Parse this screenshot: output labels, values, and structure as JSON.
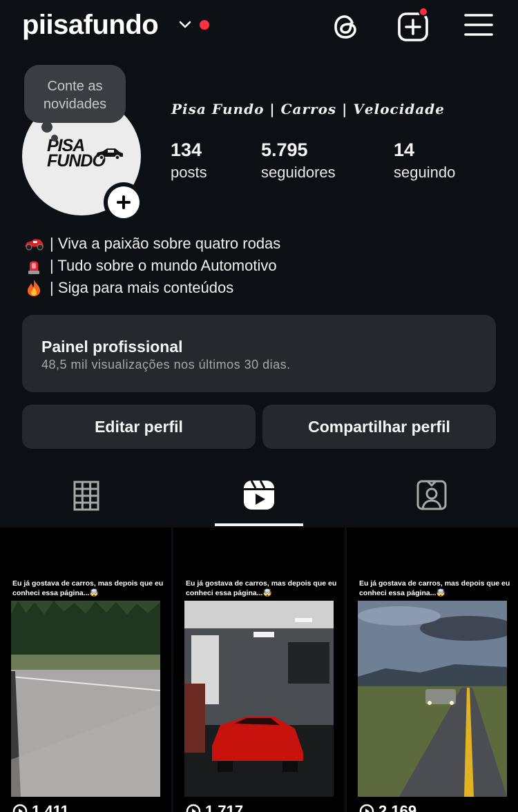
{
  "header": {
    "username": "piisafundo",
    "icons": [
      "chevron-down-icon",
      "threads-icon",
      "new-post-icon",
      "menu-icon"
    ],
    "notification_color": "#ff3040"
  },
  "profile": {
    "note_bubble": "Conte as novidades",
    "avatar_logo_line1": "PISA",
    "avatar_logo_line2": "FUNDO",
    "full_name": "𝑷𝒊𝒔𝒂 𝑭𝒖𝒏𝒅𝒐 | 𝑪𝒂𝒓𝒓𝒐𝒔 | 𝑽𝒆𝒍𝒐𝒄𝒊𝒅𝒂𝒅𝒆",
    "stats": [
      {
        "value": "134",
        "label": "posts"
      },
      {
        "value": "5.795",
        "label": "seguidores"
      },
      {
        "value": "14",
        "label": "seguindo"
      }
    ],
    "bio": [
      {
        "icon": "race-car-icon",
        "text": "| Viva a paixão sobre quatro rodas"
      },
      {
        "icon": "siren-icon",
        "text": "| Tudo sobre o mundo Automotivo"
      },
      {
        "icon": "fire-icon",
        "text": "| Siga para mais conteúdos"
      }
    ]
  },
  "professional_dashboard": {
    "title": "Painel profissional",
    "subtitle": "48,5 mil visualizações nos últimos 30 dias."
  },
  "buttons": {
    "edit": "Editar perfil",
    "share": "Compartilhar perfil"
  },
  "tabs": {
    "items": [
      "grid-icon",
      "reels-icon",
      "tagged-icon"
    ],
    "active": "reels-icon"
  },
  "reels": [
    {
      "caption": "Eu já gostava de carros, mas depois que eu conheci essa página...🤯",
      "views": "1.411"
    },
    {
      "caption": "Eu já gostava de carros, mas depois que eu conheci essa página...🤯",
      "views": "1.717"
    },
    {
      "caption": "Eu já gostava de carros, mas depois que eu conheci essa página...🤯",
      "views": "2.169"
    }
  ]
}
